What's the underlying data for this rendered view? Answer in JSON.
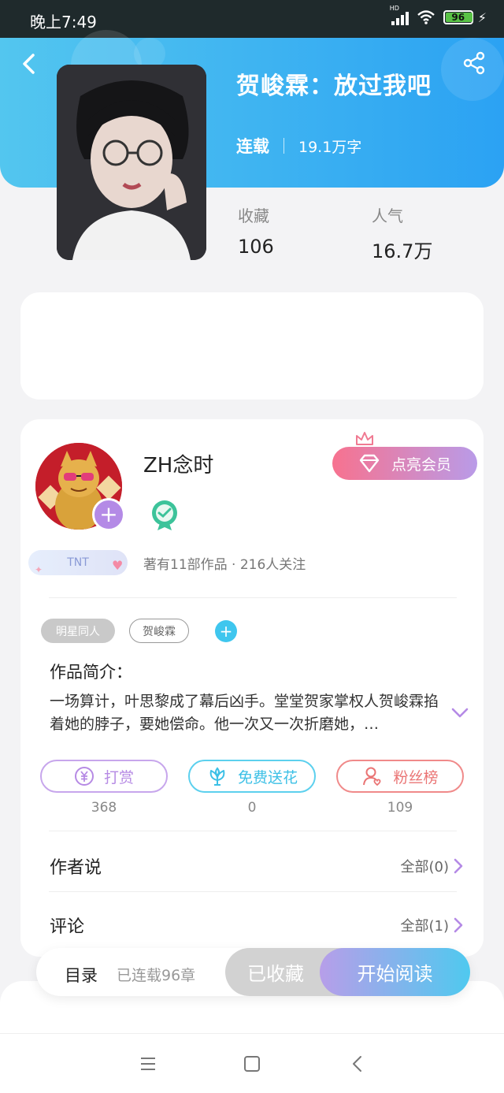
{
  "status_bar": {
    "time": "晚上7:49",
    "network": "HD",
    "battery": "96"
  },
  "book": {
    "title": "贺峻霖：放过我吧",
    "status": "连载",
    "word_count": "19.1万字",
    "stats": [
      {
        "label": "收藏",
        "value": "106"
      },
      {
        "label": "人气",
        "value": "16.7万"
      }
    ]
  },
  "author": {
    "name": "ZH念时",
    "badge": "TNT",
    "info": "著有11部作品 · 216人关注",
    "vip_button": "点亮会员"
  },
  "tags": [
    "明星同人",
    "贺峻霖"
  ],
  "intro": {
    "title": "作品简介：",
    "text": "一场算计，叶思黎成了幕后凶手。堂堂贺家掌权人贺峻霖掐着她的脖子，要她偿命。他一次又一次折磨她，…"
  },
  "actions": [
    {
      "label": "打赏",
      "count": "368",
      "icon": "yen-coin-icon"
    },
    {
      "label": "免费送花",
      "count": "0",
      "icon": "flower-icon"
    },
    {
      "label": "粉丝榜",
      "count": "109",
      "icon": "fan-user-icon"
    }
  ],
  "sections": [
    {
      "title": "作者说",
      "link": "全部(0)"
    },
    {
      "title": "评论",
      "link": "全部(1)"
    }
  ],
  "bottom_bar": {
    "catalog": "目录",
    "chapters": "已连载96章",
    "collected": "已收藏",
    "read": "开始阅读"
  },
  "colors": {
    "header_gradient_start": "#53c6ef",
    "header_gradient_end": "#2ba2f3",
    "accent_purple": "#b48ae6",
    "accent_cyan": "#3fc6ee",
    "accent_red": "#ea7474"
  }
}
